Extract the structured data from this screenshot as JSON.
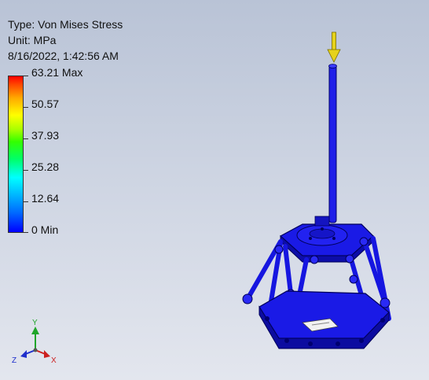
{
  "result": {
    "type": "Type: Von Mises Stress",
    "unit": "Unit: MPa",
    "timestamp": "8/16/2022, 1:42:56 AM"
  },
  "legend": {
    "labels": [
      "63.21 Max",
      "50.57",
      "37.93",
      "25.28",
      "12.64",
      "0 Min"
    ],
    "max": 63.21,
    "min": 0
  },
  "triad": {
    "x": "X",
    "y": "Y",
    "z": "Z"
  },
  "colors": {
    "model_blue": "#1a1ae6",
    "load_arrow": "#e6d21a",
    "triad_x": "#cc1f1f",
    "triad_y": "#1fa52a",
    "triad_z": "#1f2fcc"
  }
}
